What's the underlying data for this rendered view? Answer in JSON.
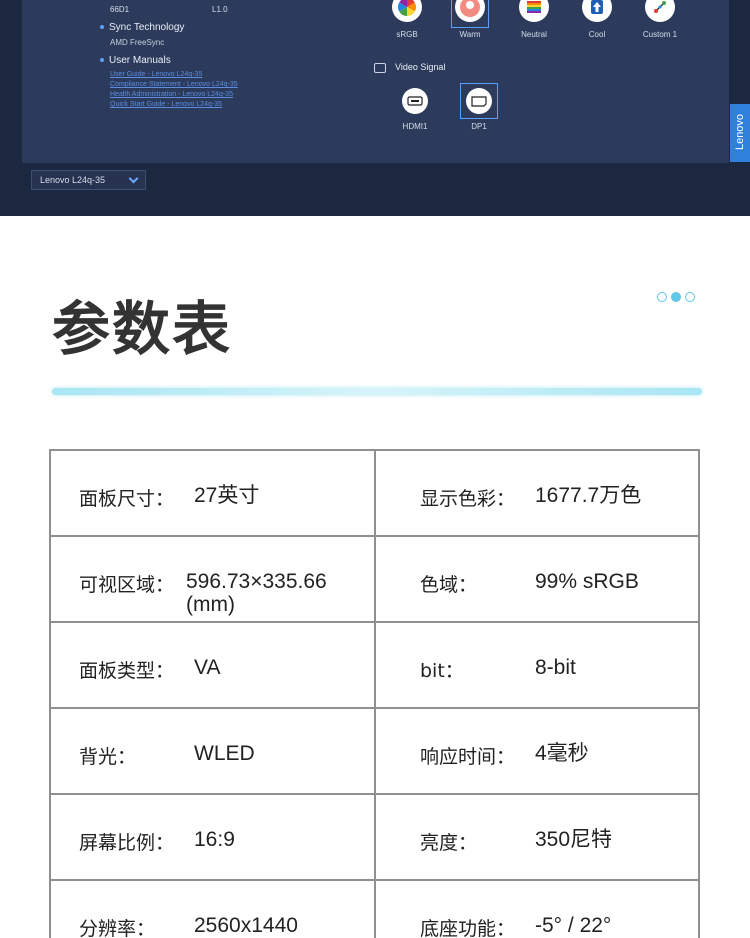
{
  "software": {
    "info": {
      "model_code": "66D1",
      "firmware": "L1.0"
    },
    "sync": {
      "title": "Sync Technology",
      "value": "AMD FreeSync"
    },
    "manuals": {
      "title": "User Manuals",
      "links": [
        "User Guide - Lenovo L24q-35",
        "Compliance Statement - Lenovo L24q-35",
        "Health Administration - Lenovo L24q-35",
        "Quick Start Guide - Lenovo L24q-35"
      ]
    },
    "color_modes": [
      {
        "label": "sRGB",
        "icon": "color-wheel-icon",
        "selected": false
      },
      {
        "label": "Warm",
        "icon": "warm-tone-icon",
        "selected": true
      },
      {
        "label": "Neutral",
        "icon": "neutral-rainbow-icon",
        "selected": false
      },
      {
        "label": "Cool",
        "icon": "cool-arrow-icon",
        "selected": false
      },
      {
        "label": "Custom 1",
        "icon": "custom-sliders-icon",
        "selected": false
      }
    ],
    "video_signal": {
      "title": "Video Signal",
      "ports": [
        {
          "label": "HDMI1",
          "badge": "HDMI",
          "selected": false
        },
        {
          "label": "DP1",
          "badge": "DP",
          "selected": true
        }
      ]
    },
    "model_select": "Lenovo L24q-35",
    "brand_tab": "Lenovo",
    "colors": {
      "panel": "#2c3b5c",
      "background": "#1c2740",
      "accent": "#2f7fdd"
    }
  },
  "section": {
    "title": "参数表",
    "pager": {
      "count": 3,
      "active": 2
    }
  },
  "specs": [
    [
      {
        "label": "面板尺寸：",
        "value": "27英寸"
      },
      {
        "label": "显示色彩：",
        "value": "1677.7万色"
      }
    ],
    [
      {
        "label": "可视区域：",
        "value": " 596.73×335.66 (mm)"
      },
      {
        "label": "色域：",
        "value": "99% sRGB"
      }
    ],
    [
      {
        "label": "面板类型：",
        "value": " VA"
      },
      {
        "label": "bit：",
        "value": "8-bit"
      }
    ],
    [
      {
        "label": "背光：",
        "value": "WLED"
      },
      {
        "label": "响应时间：",
        "value": "4毫秒"
      }
    ],
    [
      {
        "label": "屏幕比例：",
        "value": "16:9"
      },
      {
        "label": "亮度：",
        "value": "350尼特"
      }
    ],
    [
      {
        "label": "分辨率：",
        "value": "2560x1440"
      },
      {
        "label": "底座功能：",
        "value": "-5° / 22°"
      }
    ]
  ]
}
